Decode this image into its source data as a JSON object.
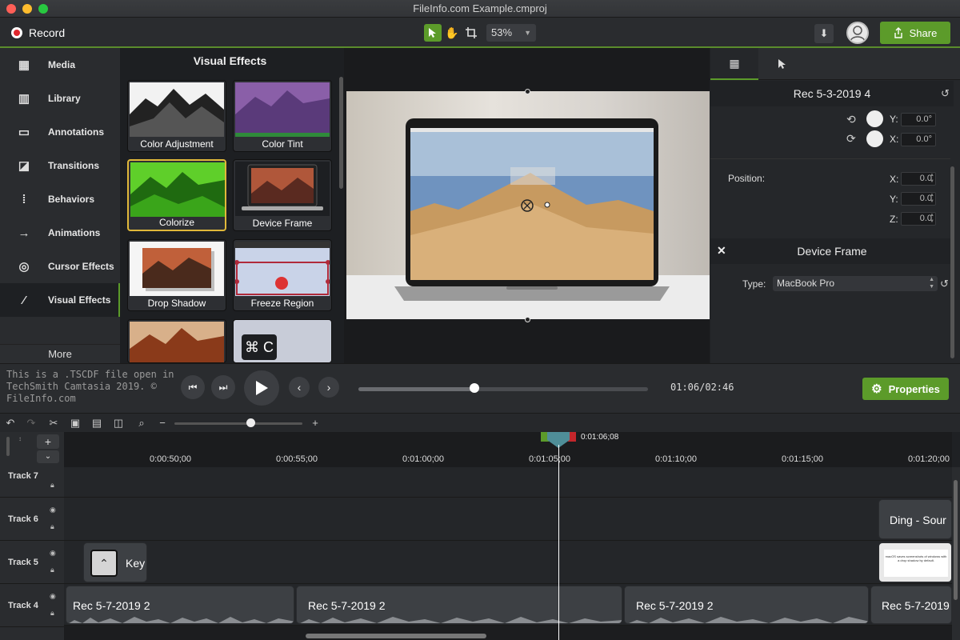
{
  "window": {
    "title": "FileInfo.com Example.cmproj"
  },
  "toolbar": {
    "record_label": "Record",
    "zoom": "53%",
    "share_label": "Share"
  },
  "nav": {
    "items": [
      {
        "label": "Media",
        "icon": "film-icon"
      },
      {
        "label": "Library",
        "icon": "library-icon"
      },
      {
        "label": "Annotations",
        "icon": "annotation-icon"
      },
      {
        "label": "Transitions",
        "icon": "transition-icon"
      },
      {
        "label": "Behaviors",
        "icon": "behaviors-icon"
      },
      {
        "label": "Animations",
        "icon": "animation-icon"
      },
      {
        "label": "Cursor Effects",
        "icon": "cursor-effects-icon"
      },
      {
        "label": "Visual Effects",
        "icon": "magic-wand-icon"
      }
    ],
    "active": "Visual Effects",
    "more_label": "More"
  },
  "effects": {
    "title": "Visual Effects",
    "tiles": [
      {
        "label": "Color Adjustment"
      },
      {
        "label": "Color Tint"
      },
      {
        "label": "Colorize",
        "selected": true
      },
      {
        "label": "Device Frame"
      },
      {
        "label": "Drop Shadow"
      },
      {
        "label": "Freeze Region"
      },
      {
        "label": ""
      },
      {
        "label": "⌘ C"
      }
    ]
  },
  "props": {
    "clip_title": "Rec 5-3-2019 4",
    "rot_y_label": "Y:",
    "rot_y": "0.0°",
    "rot_x_label": "X:",
    "rot_x": "0.0°",
    "position_label": "Position:",
    "pos_x_label": "X:",
    "pos_x": "0.0",
    "pos_y_label": "Y:",
    "pos_y": "0.0",
    "pos_z_label": "Z:",
    "pos_z": "0.0",
    "device_frame_title": "Device Frame",
    "type_label": "Type:",
    "type_value": "MacBook Pro"
  },
  "transport": {
    "watermark": "This is a .TSCDF file open in TechSmith Camtasia 2019. © FileInfo.com",
    "time": "01:06/02:46",
    "progress": 0.4,
    "properties_label": "Properties"
  },
  "timeline": {
    "playhead_time": "0:01:06;08",
    "ticks": [
      "0:00:50;00",
      "0:00:55;00",
      "0:01:00;00",
      "0:01:05;00",
      "0:01:10;00",
      "0:01:15;00",
      "0:01:20;00"
    ],
    "tracks": [
      {
        "name": "Track 7"
      },
      {
        "name": "Track 6"
      },
      {
        "name": "Track 5"
      },
      {
        "name": "Track 4"
      }
    ],
    "clips": {
      "track6_clip": "Ding - Sour",
      "track5_clip": "Key",
      "track5_callout": "macOS saves screenshots of windows with a drop shadow by default.",
      "track4": [
        "Rec 5-7-2019 2",
        "Rec 5-7-2019 2",
        "Rec 5-7-2019 2",
        "Rec 5-7-2019"
      ]
    }
  },
  "colors": {
    "accent_green": "#5c9b2a",
    "record_red": "#e0272d",
    "selection_gold": "#e0b83a"
  }
}
